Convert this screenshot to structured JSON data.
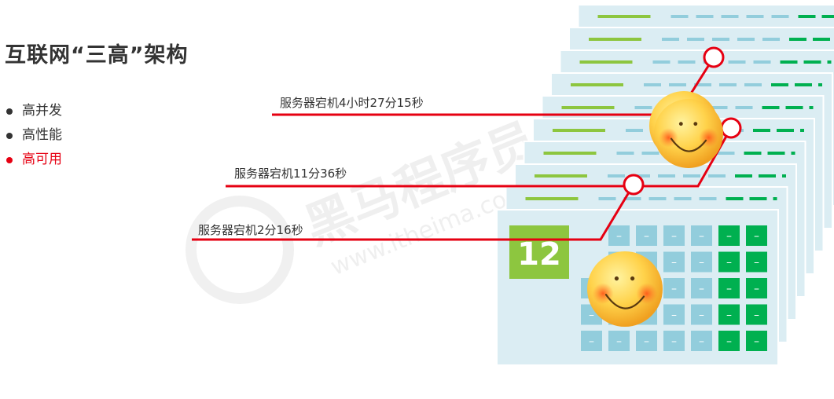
{
  "title": "互联网“三高”架构",
  "bullets": [
    {
      "label": "高并发",
      "active": false
    },
    {
      "label": "高性能",
      "active": false
    },
    {
      "label": "高可用",
      "active": true
    }
  ],
  "downtime_labels": [
    "服务器宕机4小时27分15秒",
    "服务器宕机11分36秒",
    "服务器宕机2分16秒"
  ],
  "calendar": {
    "day": "12",
    "cell_mark": "–"
  },
  "watermark": "黑马程序员 www.itheima.com",
  "colors": {
    "accent_red": "#e60012",
    "panel_bg": "#dbedf3",
    "cell_blue": "#92cddc",
    "cell_green": "#00b050",
    "light_green": "#8dc63f",
    "text": "#333333"
  },
  "icons": [
    "smiley-face-icon",
    "calendar-icon"
  ]
}
